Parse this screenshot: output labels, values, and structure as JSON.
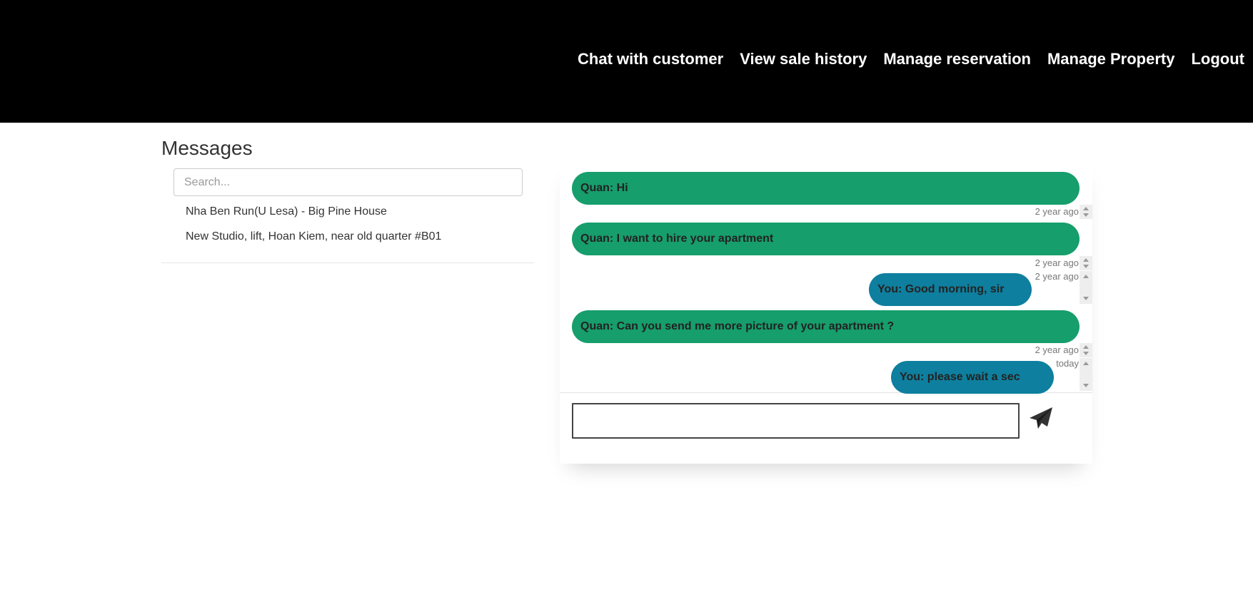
{
  "nav": {
    "items": [
      "Chat with customer",
      "View sale history",
      "Manage reservation",
      "Manage Property",
      "Logout"
    ]
  },
  "sidebar": {
    "title": "Messages",
    "search_placeholder": "Search...",
    "conversations": [
      "Nha Ben Run(U Lesa) - Big Pine House",
      "New Studio, lift, Hoan Kiem, near old quarter #B01"
    ]
  },
  "chat": {
    "messages": [
      {
        "sender": "them",
        "text": "Quan: Hi",
        "time": "2 year ago"
      },
      {
        "sender": "them",
        "text": "Quan: I want to hire your apartment",
        "time": "2 year ago"
      },
      {
        "sender": "me",
        "text": "You: Good morning, sir",
        "time": "2 year ago"
      },
      {
        "sender": "them",
        "text": "Quan: Can you send me more picture of your apartment ?",
        "time": "2 year ago"
      },
      {
        "sender": "me",
        "text": "You: please wait a sec",
        "time": "today"
      }
    ],
    "composer_value": ""
  },
  "colors": {
    "header_bg": "#000000",
    "incoming_bubble": "#169e6c",
    "outgoing_bubble": "#0e7f9e"
  },
  "icons": {
    "send": "paper-plane-icon"
  }
}
